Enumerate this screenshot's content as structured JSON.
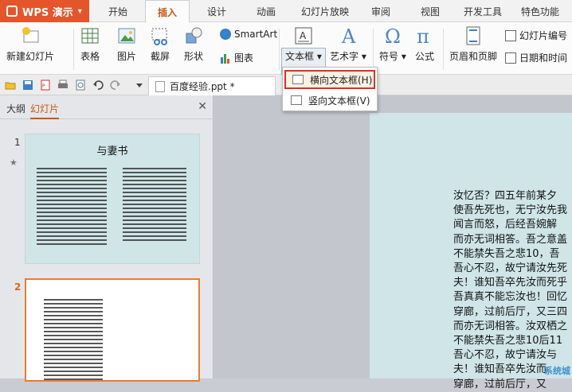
{
  "app": {
    "name": "WPS 演示"
  },
  "tabs": [
    "开始",
    "插入",
    "设计",
    "动画",
    "幻灯片放映",
    "审阅",
    "视图",
    "开发工具",
    "特色功能"
  ],
  "active_tab": "插入",
  "ribbon": {
    "new_slide": "新建幻灯片",
    "table": "表格",
    "image": "图片",
    "screenshot": "截屏",
    "shapes": "形状",
    "smartart": "SmartArt",
    "chart": "图表",
    "textbox": "文本框",
    "wordart": "艺术字",
    "symbol": "符号",
    "formula": "公式",
    "header_footer": "页眉和页脚",
    "slide_number": "幻灯片编号",
    "date_time": "日期和时间"
  },
  "document": {
    "tab_title": "百度经验.ppt *"
  },
  "dropdown": {
    "items": [
      "横向文本框(H)",
      "竖向文本框(V)"
    ],
    "highlighted_index": 0
  },
  "left_panel": {
    "tabs": [
      "大纲",
      "幻灯片"
    ],
    "active_tab": "幻灯片",
    "slides": [
      {
        "number": "1",
        "title": "与妻书"
      },
      {
        "number": "2"
      }
    ]
  },
  "slide_text": [
    "汝忆否？四五年前某夕",
    "使吾先死也，无宁汝先我",
    "闻言而怒，后经吾婉解",
    "而亦无词相答。吾之意盖",
    "不能禁失吾之悲10，吾",
    "吾心不忍，故宁请汝先死",
    "夫！谁知吾卒先汝而死乎",
    "吾真真不能忘汝也！回忆",
    "穿廊，过前后厅，又三四",
    "而亦无词相答。汝双栖之",
    "不能禁失吾之悲10后11",
    "吾心不忍，故宁请汝与",
    "夫！谁知吾卒先汝而",
    "穿廊，过前后厅，又"
  ],
  "watermark": "系统城",
  "colors": {
    "accent": "#e4552c",
    "active_tab_text": "#c55a11",
    "slide_bg": "#cfe5e8",
    "highlight_border": "#d9302c"
  }
}
